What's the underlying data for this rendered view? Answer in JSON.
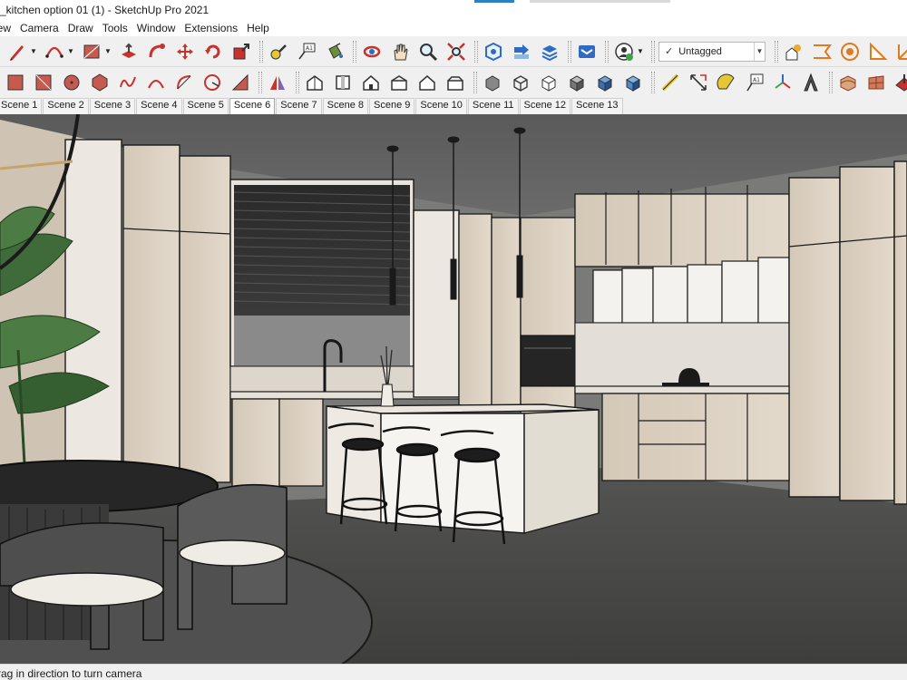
{
  "window": {
    "title": "_kitchen option 01 (1) - SketchUp Pro 2021"
  },
  "menu": {
    "items": [
      "iew",
      "Camera",
      "Draw",
      "Tools",
      "Window",
      "Extensions",
      "Help"
    ]
  },
  "toolbar": {
    "tag_value": "Untagged",
    "tag_check": "✓"
  },
  "scenes": {
    "tabs": [
      "Scene 1",
      "Scene 2",
      "Scene 3",
      "Scene 4",
      "Scene 5",
      "Scene 6",
      "Scene 7",
      "Scene 8",
      "Scene 9",
      "Scene 10",
      "Scene 11",
      "Scene 12",
      "Scene 13"
    ],
    "active_index": 5
  },
  "status": {
    "text": "rag in direction to turn camera"
  },
  "colors": {
    "accent": "#2f7fc4",
    "red_tool": "#c8312c",
    "ceiling": "#5e5e5e",
    "floor": "#4a4a48",
    "cabinet_wood": "#d8ccbc",
    "cabinet_white": "#f2f0ec"
  }
}
